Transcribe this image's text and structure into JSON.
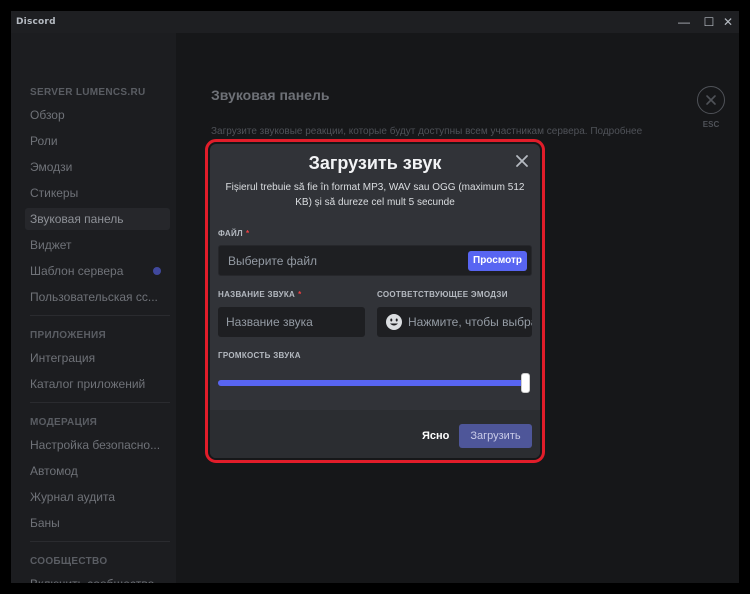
{
  "window": {
    "app_name": "Discord",
    "controls": {
      "minimize": "—",
      "maximize": "☐",
      "close": "✕"
    }
  },
  "sidebar": {
    "server_section": "SERVER LUMENCS.RU",
    "items": [
      {
        "label": "Обзор"
      },
      {
        "label": "Роли"
      },
      {
        "label": "Эмодзи"
      },
      {
        "label": "Стикеры"
      },
      {
        "label": "Звуковая панель",
        "active": true
      },
      {
        "label": "Виджет"
      },
      {
        "label": "Шаблон сервера",
        "has_dot": true
      },
      {
        "label": "Пользовательская сс..."
      }
    ],
    "apps_section": "ПРИЛОЖЕНИЯ",
    "apps_items": [
      {
        "label": "Интеграция"
      },
      {
        "label": "Каталог приложений"
      }
    ],
    "moderation_section": "МОДЕРАЦИЯ",
    "moderation_items": [
      {
        "label": "Настройка безопасно..."
      },
      {
        "label": "Автомод"
      },
      {
        "label": "Журнал аудита"
      },
      {
        "label": "Баны"
      }
    ],
    "community_section": "СООБЩЕСТВО",
    "community_items": [
      {
        "label": "Включить сообщество"
      }
    ]
  },
  "content": {
    "page_title": "Звуковая панель",
    "page_desc": "Загрузите звуковые реакции, которые будут доступны всем участникам сервера. Подробнее",
    "esc_label": "ESC"
  },
  "modal": {
    "title": "Загрузить звук",
    "subtitle": "Fișierul trebuie să fie în format MP3, WAV sau OGG (maximum 512 KB) și să dureze cel mult 5 secunde",
    "file_label": "ФАЙЛ",
    "file_placeholder": "Выберите файл",
    "browse_label": "Просмотр",
    "name_label": "НАЗВАНИЕ ЗВУКА",
    "name_placeholder": "Название звука",
    "emoji_label": "СООТВЕТСТВУЮЩЕЕ ЭМОДЗИ",
    "emoji_placeholder": "Нажмите, чтобы выбрать",
    "volume_label": "ГРОМКОСТЬ ЗВУКА",
    "volume_value": 1.0,
    "required_mark": "*",
    "cancel_label": "Ясно",
    "upload_label": "Загрузить"
  },
  "colors": {
    "accent": "#5865f2",
    "highlight_border": "#e11d2a",
    "modal_bg": "#313338"
  }
}
